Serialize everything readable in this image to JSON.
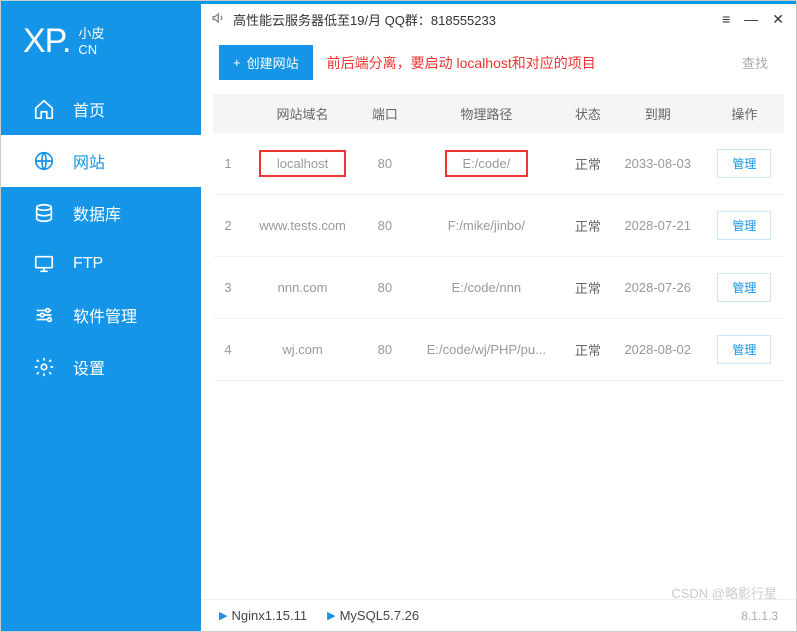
{
  "logo": {
    "main": "XP.",
    "sub1": "小皮",
    "sub2": "CN"
  },
  "sidebar": {
    "items": [
      {
        "label": "首页"
      },
      {
        "label": "网站"
      },
      {
        "label": "数据库"
      },
      {
        "label": "FTP"
      },
      {
        "label": "软件管理"
      },
      {
        "label": "设置"
      }
    ]
  },
  "titlebar": {
    "announce": "高性能云服务器低至19/月  QQ群：818555233"
  },
  "toolbar": {
    "create_label": "创建网站",
    "warning": "前后端分离，要启动 localhost和对应的项目",
    "search_label": "查找"
  },
  "table": {
    "headers": [
      "",
      "网站域名",
      "端口",
      "物理路径",
      "状态",
      "到期",
      "操作"
    ],
    "rows": [
      {
        "idx": "1",
        "domain": "localhost",
        "port": "80",
        "path": "E:/code/",
        "status": "正常",
        "expire": "2033-08-03",
        "highlight": true
      },
      {
        "idx": "2",
        "domain": "www.tests.com",
        "port": "80",
        "path": "F:/mike/jinbo/",
        "status": "正常",
        "expire": "2028-07-21",
        "highlight": false
      },
      {
        "idx": "3",
        "domain": "nnn.com",
        "port": "80",
        "path": "E:/code/nnn",
        "status": "正常",
        "expire": "2028-07-26",
        "highlight": false
      },
      {
        "idx": "4",
        "domain": "wj.com",
        "port": "80",
        "path": "E:/code/wj/PHP/pu...",
        "status": "正常",
        "expire": "2028-08-02",
        "highlight": false
      }
    ],
    "manage_label": "管理"
  },
  "footer": {
    "svc1": "Nginx1.15.11",
    "svc2": "MySQL5.7.26",
    "version": "8.1.1.3"
  },
  "watermark": "CSDN @略影行星"
}
